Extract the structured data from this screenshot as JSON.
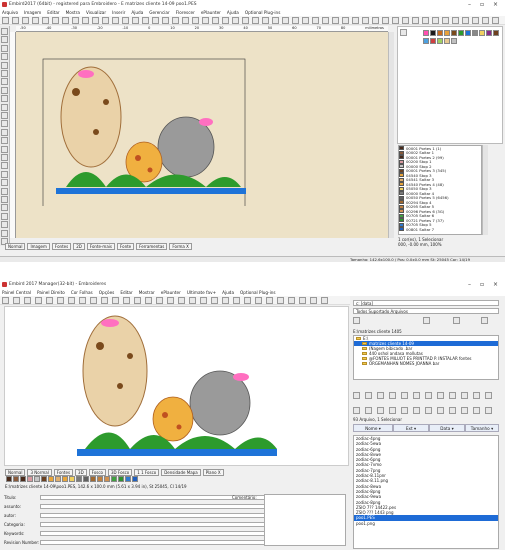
{
  "window1": {
    "title": "Embird2017 (64bit) - registered para Embroidero - E matrizes cliente 14-09 poo1.PES",
    "menu": [
      "Arquivo",
      "Imagem",
      "Editar",
      "Mostra",
      "Visualizar",
      "Inserir",
      "Ajuda",
      "Gerenciar",
      "Florescer",
      "ePlaunter",
      "Ajuda",
      "Optional Plug-ins"
    ],
    "tabs": [
      "Normal",
      "Imagem",
      "Fontes",
      "2D",
      "Fonte-mais",
      "Fonte",
      "Ferramentas",
      "Forma X"
    ],
    "ruler_labels": [
      "-50",
      "-40",
      "-30",
      "-20",
      "-10",
      "0",
      "10",
      "20",
      "30",
      "40",
      "50",
      "60",
      "70",
      "80"
    ],
    "ruler_unit": "milimetros",
    "colors": [
      {
        "id": "00001",
        "name": "Portes 1 (1)",
        "hex": "#4a2a1a"
      },
      {
        "id": "00002",
        "name": "Saltar 1",
        "hex": "#8a5a3a"
      },
      {
        "id": "00001",
        "name": "Portes 2 (99)",
        "hex": "#4a2a1a"
      },
      {
        "id": "00200",
        "name": "Stop 1",
        "hex": "#d99aa0"
      },
      {
        "id": "00000",
        "name": "Stop 2",
        "hex": "#c5c5c5"
      },
      {
        "id": "00001",
        "name": "Portes 3 (345)",
        "hex": "#6a4020"
      },
      {
        "id": "04540",
        "name": "Stop 3",
        "hex": "#e8a53a"
      },
      {
        "id": "04541",
        "name": "Saltar 3",
        "hex": "#e0b070"
      },
      {
        "id": "04540",
        "name": "Portes 4 (48)",
        "hex": "#e8a53a"
      },
      {
        "id": "05050",
        "name": "Stop 3",
        "hex": "#f0d060"
      },
      {
        "id": "00000",
        "name": "Saltar 4",
        "hex": "#7a7a7a"
      },
      {
        "id": "00050",
        "name": "Portes 5 (6456)",
        "hex": "#606060"
      },
      {
        "id": "00294",
        "name": "Stop 4",
        "hex": "#a06830"
      },
      {
        "id": "00295",
        "name": "Saltar 5",
        "hex": "#c08040"
      },
      {
        "id": "00296",
        "name": "Portes 6 (3G)",
        "hex": "#d09050"
      },
      {
        "id": "00705",
        "name": "Saltar 6",
        "hex": "#40a040"
      },
      {
        "id": "00721",
        "name": "Portes 7 (37)",
        "hex": "#309030"
      },
      {
        "id": "00705",
        "name": "Stop 5",
        "hex": "#2f7ad0"
      },
      {
        "id": "00801",
        "name": "Saltar 7",
        "hex": "#2060c0"
      }
    ],
    "color_info": [
      "1 cor(es), 1 Selecionar",
      "000, -0.00 mm, 100%"
    ],
    "status_right": "Tamanho: 142.6x100.0 / Pos: 0.0x0.0 mm   St: 25045   Cor: 14/19",
    "palette_colors": [
      "#ff4fb0",
      "#1a1a1a",
      "#c76a1f",
      "#e8a13a",
      "#7a4a1c",
      "#2d9b2d",
      "#1e73d8",
      "#888",
      "#f0d060",
      "#8a2a8a",
      "#6d3f1e",
      "#4ca0e0",
      "#d04040",
      "#a0d060",
      "#e8c890",
      "#c0c0c0"
    ]
  },
  "window2": {
    "title": "Embird 2017 Manager(32-bit) - Embroideres",
    "menu": [
      "Painel Central",
      "Painel Direito",
      "Cor Folhas",
      "Opções",
      "Editar",
      "Mostrar",
      "ePlaunter",
      "Ultimate fav+",
      "Ajuda",
      "Optional Plug-ins"
    ],
    "tabs": [
      "Normal",
      "3 Normal",
      "Fontes",
      "3D",
      "Fosco",
      "3D Fosco",
      "1 1 Fosco",
      "Densidade Mapa",
      "Plano X"
    ],
    "file_info": "E:\\matrizes cliente 14-09\\poo1.PES, 142.6 x 100.0 mm (5.61 x 3.94 in), St 25045, Cl 14/19",
    "form": {
      "labels": [
        "Titulo:",
        "assunto:",
        "autor:",
        "Categoria:",
        "Keywords:",
        "Revision Number:"
      ],
      "comment_label": "Comentário:"
    },
    "drive": "c: [data]",
    "dest_label": "Todos Suportado Arquivos",
    "path": "E:\\matrizes cliente 1405",
    "tree": [
      {
        "label": "E:\\",
        "sel": false
      },
      {
        "label": "matrizes cliente 14-09",
        "sel": true
      },
      {
        "label": "(Nagem bibicado .bar",
        "sel": false
      },
      {
        "label": "440 oshol andasa mollutas",
        "sel": false
      },
      {
        "label": "@FONTES MILUOT ES PRINTTAD P. INSTALAR fontes",
        "sel": false
      },
      {
        "label": "ORGEMANHAN NOMES JOANNA bar",
        "sel": false
      }
    ],
    "file_count": "93 Arquivo, 1 Selecionar",
    "columns": [
      "Nome",
      "Ext",
      "Data",
      "Tamanho"
    ],
    "files": [
      "zodiac-4png",
      "zodiac-5ewa",
      "zodiac-6png",
      "zodiac-8vwe",
      "zodiac-6png",
      "zodiac-7vmo",
      "zodiac-7png",
      "zodiac-8.11pnr",
      "zodiac-8.11.png",
      "zodiac-8ewa",
      "zodiac-8png",
      "zodiac-9ewa",
      "zodiac-8png",
      "ZSIO 7?? 14422.pes",
      "ZSIO ??? 1443 png",
      "poo1.PES",
      "poo1.png"
    ],
    "selected_file": "poo1.PES"
  }
}
